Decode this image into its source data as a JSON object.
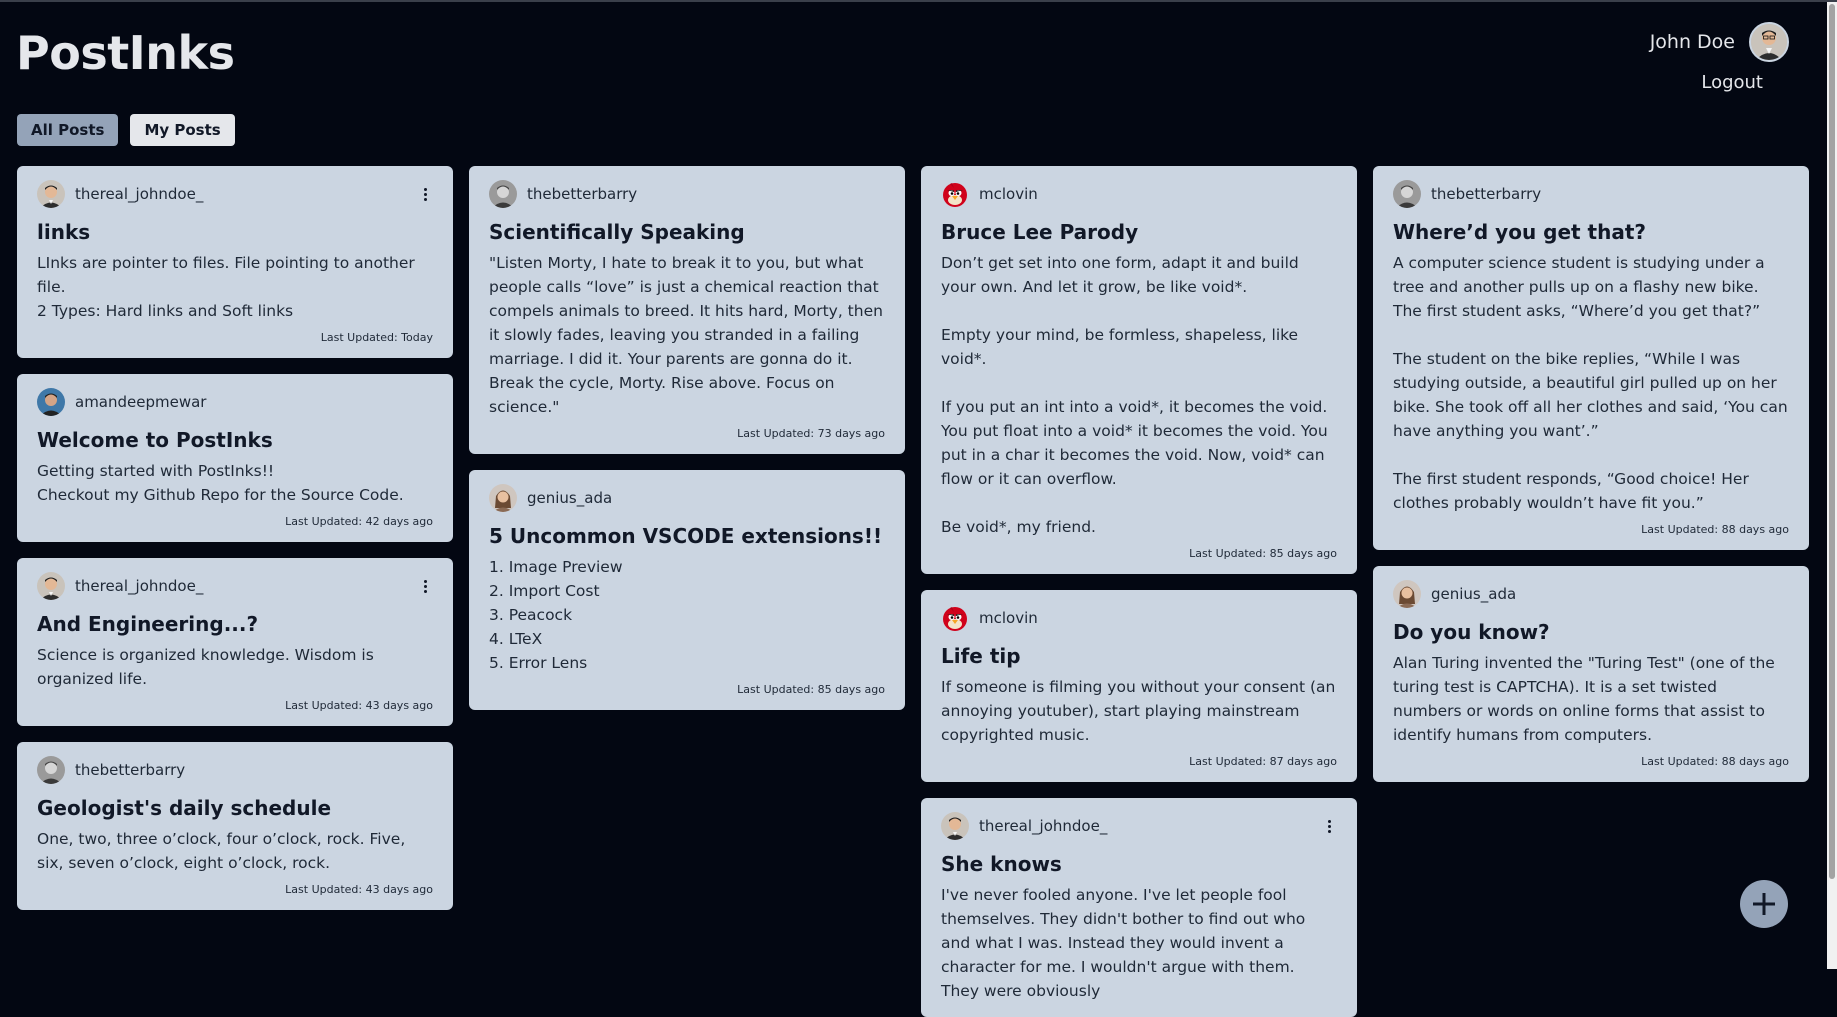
{
  "app": {
    "title": "PostInks"
  },
  "user": {
    "name": "John Doe",
    "logout_label": "Logout"
  },
  "filters": {
    "all_label": "All Posts",
    "mine_label": "My Posts"
  },
  "colors": {
    "background": "#030712",
    "card": "#cbd5e1",
    "active_filter": "#94a3b8",
    "fab": "#94a3b8"
  },
  "columns": [
    [
      {
        "user": "thereal_johndoe_",
        "avatar": "man-avatar-icon",
        "menu": true,
        "title": "links",
        "body": "LInks are pointer to files. File pointing to another file.\n2 Types: Hard links and Soft links",
        "updated": "Last Updated: Today"
      },
      {
        "user": "amandeepmewar",
        "avatar": "man-blue-avatar-icon",
        "menu": false,
        "title": "Welcome to PostInks",
        "body": "Getting started with PostInks!!\nCheckout my Github Repo for the Source Code.",
        "updated": "Last Updated: 42 days ago"
      },
      {
        "user": "thereal_johndoe_",
        "avatar": "man-avatar-icon",
        "menu": true,
        "title": "And Engineering...?",
        "body": "Science is organized knowledge. Wisdom is organized life.",
        "updated": "Last Updated: 43 days ago"
      },
      {
        "user": "thebetterbarry",
        "avatar": "gray-man-avatar-icon",
        "menu": false,
        "title": "Geologist's daily schedule",
        "body": "One, two, three o’clock, four o’clock, rock. Five, six, seven o’clock, eight o’clock, rock.",
        "updated": "Last Updated: 43 days ago"
      }
    ],
    [
      {
        "user": "thebetterbarry",
        "avatar": "gray-man-avatar-icon",
        "menu": false,
        "title": "Scientifically Speaking",
        "body": "\"Listen Morty, I hate to break it to you, but what people calls “love” is just a chemical reaction that compels animals to breed. It hits hard, Morty, then it slowly fades, leaving you stranded in a failing marriage. I did it. Your parents are gonna do it. Break the cycle, Morty. Rise above. Focus on science.\"",
        "updated": "Last Updated: 73 days ago"
      },
      {
        "user": "genius_ada",
        "avatar": "woman-avatar-icon",
        "menu": false,
        "title": "5 Uncommon VSCODE extensions!!",
        "body": "1. Image Preview\n2. Import Cost\n3. Peacock\n4. LTeX\n5. Error Lens",
        "updated": "Last Updated: 85 days ago"
      }
    ],
    [
      {
        "user": "mclovin",
        "avatar": "angry-bird-avatar-icon",
        "menu": false,
        "title": "Bruce Lee Parody",
        "body": "Don’t get set into one form, adapt it and build your own. And let it grow, be like void*.\n\nEmpty your mind, be formless, shapeless, like void*.\n\nIf you put an int into a void*, it becomes the void. You put float into a void* it becomes the void. You put in a char it becomes the void. Now, void* can flow or it can overflow.\n\nBe void*, my friend.",
        "updated": "Last Updated: 85 days ago"
      },
      {
        "user": "mclovin",
        "avatar": "angry-bird-avatar-icon",
        "menu": false,
        "title": "Life tip",
        "body": "If someone is filming you without your consent (an annoying youtuber), start playing mainstream copyrighted music.",
        "updated": "Last Updated: 87 days ago"
      },
      {
        "user": "thereal_johndoe_",
        "avatar": "man-avatar-icon",
        "menu": true,
        "title": "She knows",
        "body": "I've never fooled anyone. I've let people fool themselves. They didn't bother to find out who and what I was. Instead they would invent a character for me. I wouldn't argue with them. They were obviously",
        "updated": ""
      }
    ],
    [
      {
        "user": "thebetterbarry",
        "avatar": "gray-man-avatar-icon",
        "menu": false,
        "title": "Where’d you get that?",
        "body": "A computer science student is studying under a tree and another pulls up on a flashy new bike. The first student asks, “Where’d you get that?”\n\nThe student on the bike replies, “While I was studying outside, a beautiful girl pulled up on her bike. She took off all her clothes and said, ‘You can have anything you want’.”\n\nThe first student responds, “Good choice! Her clothes probably wouldn’t have fit you.”",
        "updated": "Last Updated: 88 days ago"
      },
      {
        "user": "genius_ada",
        "avatar": "woman-avatar-icon",
        "menu": false,
        "title": "Do you know?",
        "body": "Alan Turing invented the \"Turing Test\" (one of the turing test is CAPTCHA). It is a set twisted numbers or words on online forms that assist to identify humans from computers.",
        "updated": "Last Updated: 88 days ago"
      }
    ]
  ]
}
